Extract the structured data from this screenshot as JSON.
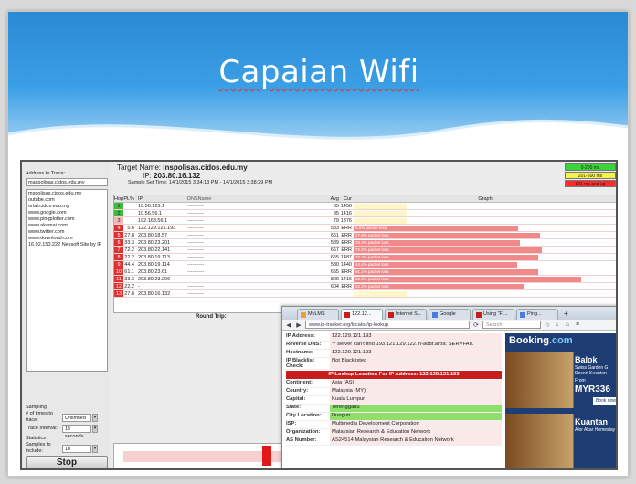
{
  "slide": {
    "title": "Capaian Wifi"
  },
  "app": {
    "address_label": "Address to Trace:",
    "address_value": "maspolisas.cidos.edu.my",
    "address_list": [
      "mspolisas.cidos.edu.my",
      "outube.com",
      "ortal.cidos.edu.my",
      "www.google.com",
      "www.pingplotter.com",
      "www.akamai.com",
      "www.twitter.com",
      "www.download.com",
      "16.92.150.222 Nessoft Site by IP"
    ],
    "target_name_label": "Target Name:",
    "target_name": "inspolisas.cidos.edu.my",
    "ip_label": "IP:",
    "ip": "203.80.16.132",
    "sample_time": "Sample Set Time: 14/1/2015 3:34:13 PM - 14/1/2015 3:38:29 PM",
    "legend": [
      {
        "label": "0-200 ms",
        "color": "#39d639"
      },
      {
        "label": "201-500 ms",
        "color": "#f6f34a"
      },
      {
        "label": "501 ms and up",
        "color": "#ff2b2b"
      }
    ],
    "columns": {
      "hop": "Hop",
      "pl": "PL%",
      "ip": "IP",
      "dns": "DNSName",
      "avg": "Avg",
      "cur": "Cur",
      "graph": "Graph"
    },
    "rows": [
      {
        "hop": "1",
        "pl": "",
        "ip": "10.56.123.1",
        "dns": "----------",
        "avg": "85",
        "cur": "1456",
        "status": "green",
        "note": ""
      },
      {
        "hop": "2",
        "pl": "",
        "ip": "10.56.56.1",
        "dns": "----------",
        "avg": "85",
        "cur": "1416",
        "status": "green",
        "note": ""
      },
      {
        "hop": "3",
        "pl": "",
        "ip": "192.168.56.1",
        "dns": "----------",
        "avg": "79",
        "cur": "1376",
        "status": "lightred",
        "note": ""
      },
      {
        "hop": "4",
        "pl": "5.6",
        "ip": "122.129.121.193",
        "dns": "----------",
        "avg": "583",
        "cur": "ERR",
        "status": "red",
        "note": "5.6% packet loss"
      },
      {
        "hop": "5",
        "pl": "27.8",
        "ip": "203.80.18.57",
        "dns": "----------",
        "avg": "661",
        "cur": "ERR",
        "status": "red",
        "note": "27.8% packet loss"
      },
      {
        "hop": "6",
        "pl": "33.3",
        "ip": "203.80.23.201",
        "dns": "----------",
        "avg": "589",
        "cur": "ERR",
        "status": "red",
        "note": "33.3% packet loss"
      },
      {
        "hop": "7",
        "pl": "72.2",
        "ip": "203.80.22.141",
        "dns": "----------",
        "avg": "667",
        "cur": "ERR",
        "status": "red",
        "note": "72.2% packet loss"
      },
      {
        "hop": "8",
        "pl": "22.2",
        "ip": "203.80.19.113",
        "dns": "----------",
        "avg": "655",
        "cur": "1487",
        "status": "red",
        "note": "22.2% packet loss"
      },
      {
        "hop": "9",
        "pl": "44.4",
        "ip": "203.80.19.114",
        "dns": "----------",
        "avg": "580",
        "cur": "1440",
        "status": "red",
        "note": "44.4% packet loss"
      },
      {
        "hop": "10",
        "pl": "61.1",
        "ip": "203.80.23.61",
        "dns": "----------",
        "avg": "655",
        "cur": "ERR",
        "status": "red",
        "note": "61.1% packet loss"
      },
      {
        "hop": "11",
        "pl": "33.3",
        "ip": "203.80.23.206",
        "dns": "----------",
        "avg": "809",
        "cur": "1416",
        "status": "red",
        "note": "33.3% packet loss"
      },
      {
        "hop": "12",
        "pl": "22.2",
        "ip": "-",
        "dns": "----------",
        "avg": "604",
        "cur": "ERR",
        "status": "red",
        "note": "22.2% packet loss"
      },
      {
        "hop": "13",
        "pl": "27.8",
        "ip": "203.80.16.132",
        "dns": "----------",
        "avg": "",
        "cur": "",
        "status": "red",
        "note": "27.8% packet loss"
      }
    ],
    "round_trip": "Round Trip:",
    "sampling": {
      "title": "Sampling",
      "times_label": "# of times to trace:",
      "times_value": "Unlimited",
      "interval_label": "Trace Interval:",
      "interval_value": "15 seconds",
      "statistics_title": "Statistics",
      "samples_label": "Samples to include:",
      "samples_value": "10"
    },
    "stop_label": "Stop"
  },
  "browser": {
    "tabs": [
      {
        "label": "MyLMS",
        "color": "#f0a030"
      },
      {
        "label": "122.12...",
        "color": "#c91d1d"
      },
      {
        "label": "Internet S...",
        "color": "#c91d1d"
      },
      {
        "label": "Google",
        "color": "#4a7de0"
      },
      {
        "label": "Using \"Fi...",
        "color": "#c91d1d"
      },
      {
        "label": "Ping...",
        "color": "#4a7de0"
      }
    ],
    "new_tab": "+",
    "url": "www.ip-tracker.org/locator/ip-lookup",
    "search_placeholder": "Search",
    "lookup": {
      "ip_address_label": "IP Address:",
      "ip_address": "122.129.121.193",
      "reverse_dns_label": "Reverse DNS:",
      "reverse_dns": "** server can't find 193.121.129.122.in-addr.arpa: SERVFAIL",
      "hostname_label": "Hostname:",
      "hostname": "122.129.121.193",
      "blacklist_label": "IP Blacklist Check:",
      "blacklist": "Not Blacklisted",
      "banner": "IP Lookup Location For IP Address: 122.129.121.193",
      "continent_label": "Continent:",
      "continent": "Asia (AS)",
      "country_label": "Country:",
      "country": "Malaysia (MY)",
      "capital_label": "Capital:",
      "capital": "Kuala Lumpur",
      "state_label": "State:",
      "state": "Terengganu",
      "city_label": "City Location:",
      "city": "Dungun",
      "isp_label": "ISP:",
      "isp": "Multimedia Development Corporation",
      "org_label": "Organization:",
      "org": "Malaysian Research & Education Network",
      "as_label": "AS Number:",
      "as": "AS24514 Malaysian Research & Education Network"
    },
    "ad": {
      "logo_main": "Booking",
      "logo_suffix": ".com",
      "hotel1": "Balok",
      "hotel1_desc": "Swiss Garden G Resort Kuantan",
      "price_label": "From",
      "price": "MYR336",
      "book": "Book now",
      "hotel2": "Kuantan",
      "hotel2_desc": "Alor Akar Homestay"
    }
  }
}
